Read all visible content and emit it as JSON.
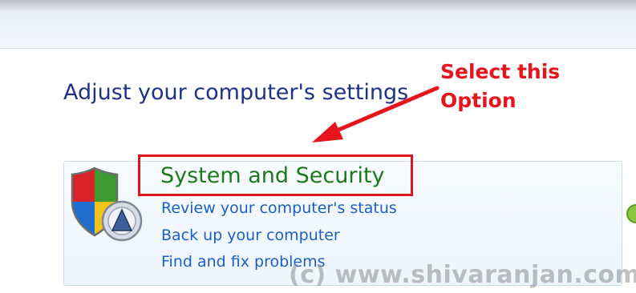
{
  "page": {
    "title": "Adjust your computer's settings"
  },
  "category": {
    "title": "System and Security",
    "icon": "shield-with-gauge-icon",
    "links": [
      "Review your computer's status",
      "Back up your computer",
      "Find and fix problems"
    ]
  },
  "annotation": {
    "line1": "Select this",
    "line2": "Option",
    "color": "#e8141c"
  },
  "watermark": {
    "text": "(c) www.shivaranjan.com"
  },
  "colors": {
    "title_blue": "#1e3287",
    "category_green": "#1c7a1c",
    "link_blue": "#1b5fc8",
    "panel_border": "#c9dcf1"
  }
}
